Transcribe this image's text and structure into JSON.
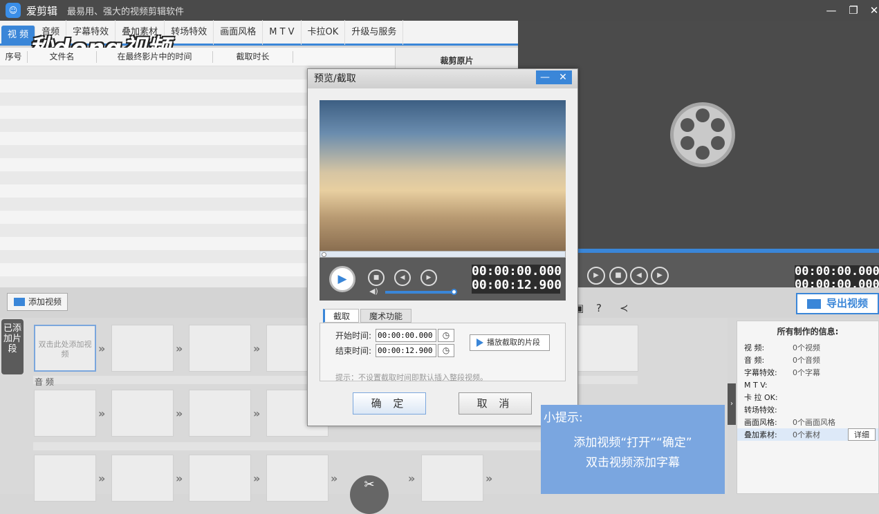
{
  "app": {
    "name": "爱剪辑",
    "slogan": "最易用、强大的视频剪辑软件"
  },
  "watermark": "秒dong视频",
  "tabs": [
    "视  频",
    "音频",
    "字幕特效",
    "叠加素材",
    "转场特效",
    "画面风格",
    "M T V",
    "卡拉OK",
    "升级与服务"
  ],
  "list_headers": {
    "index": "序号",
    "filename": "文件名",
    "time_in_movie": "在最终影片中的时间",
    "duration": "截取时长"
  },
  "cut_title": "裁剪原片",
  "add_video": "添加视频",
  "export": "导出视频",
  "right_player": {
    "time1": "00:00:00.000",
    "time2": "00:00:00.000"
  },
  "timeline": {
    "vlabel": "已添加片段",
    "first_slot": "双击此处添加视频",
    "audio_label": "音 频"
  },
  "info": {
    "title": "所有制作的信息:",
    "rows": [
      {
        "k": "视    频:",
        "v": "0个视频"
      },
      {
        "k": "音    频:",
        "v": "0个音频"
      },
      {
        "k": "字幕特效:",
        "v": "0个字幕"
      },
      {
        "k": "M  T  V:",
        "v": ""
      },
      {
        "k": "卡 拉 OK:",
        "v": ""
      },
      {
        "k": "转场特效:",
        "v": ""
      },
      {
        "k": "画面风格:",
        "v": "0个画面风格"
      },
      {
        "k": "叠加素材:",
        "v": "0个素材"
      }
    ],
    "detail": "详细"
  },
  "dialog": {
    "title": "预览/截取",
    "time_current": "00:00:00.000",
    "time_total": "00:00:12.900",
    "tabs": [
      "截取",
      "魔术功能"
    ],
    "start_label": "开始时间:",
    "start_value": "00:00:00.000",
    "end_label": "结束时间:",
    "end_value": "00:00:12.900",
    "play_clip": "播放截取的片段",
    "hint": "提示：不设置截取时间即默认插入整段视频。",
    "ok": "确 定",
    "cancel": "取 消"
  },
  "tip": {
    "title": "小提示:",
    "line1": "添加视频“打开”“确定”",
    "line2": "双击视频添加字幕"
  }
}
